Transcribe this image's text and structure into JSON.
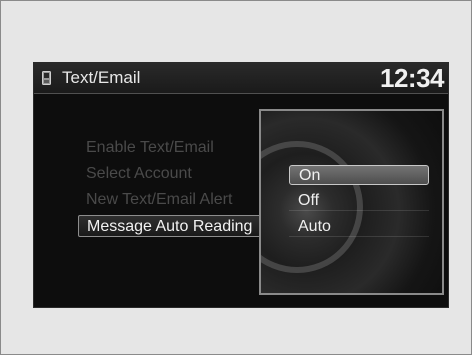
{
  "header": {
    "title": "Text/Email",
    "clock": "12:34"
  },
  "menu": {
    "items": [
      {
        "label": "Enable Text/Email",
        "state": "disabled"
      },
      {
        "label": "Select Account",
        "state": "disabled"
      },
      {
        "label": "New Text/Email Alert",
        "state": "disabled"
      },
      {
        "label": "Message Auto Reading",
        "state": "active"
      }
    ]
  },
  "popup": {
    "options": [
      {
        "label": "On",
        "selected": true
      },
      {
        "label": "Off",
        "selected": false
      },
      {
        "label": "Auto",
        "selected": false
      }
    ]
  },
  "icons": {
    "phone": "phone-icon"
  },
  "colors": {
    "screen_bg": "#0d0d0d",
    "text_active": "#f2f2f2",
    "text_disabled": "#4a4a4a",
    "highlight": "#737373"
  }
}
